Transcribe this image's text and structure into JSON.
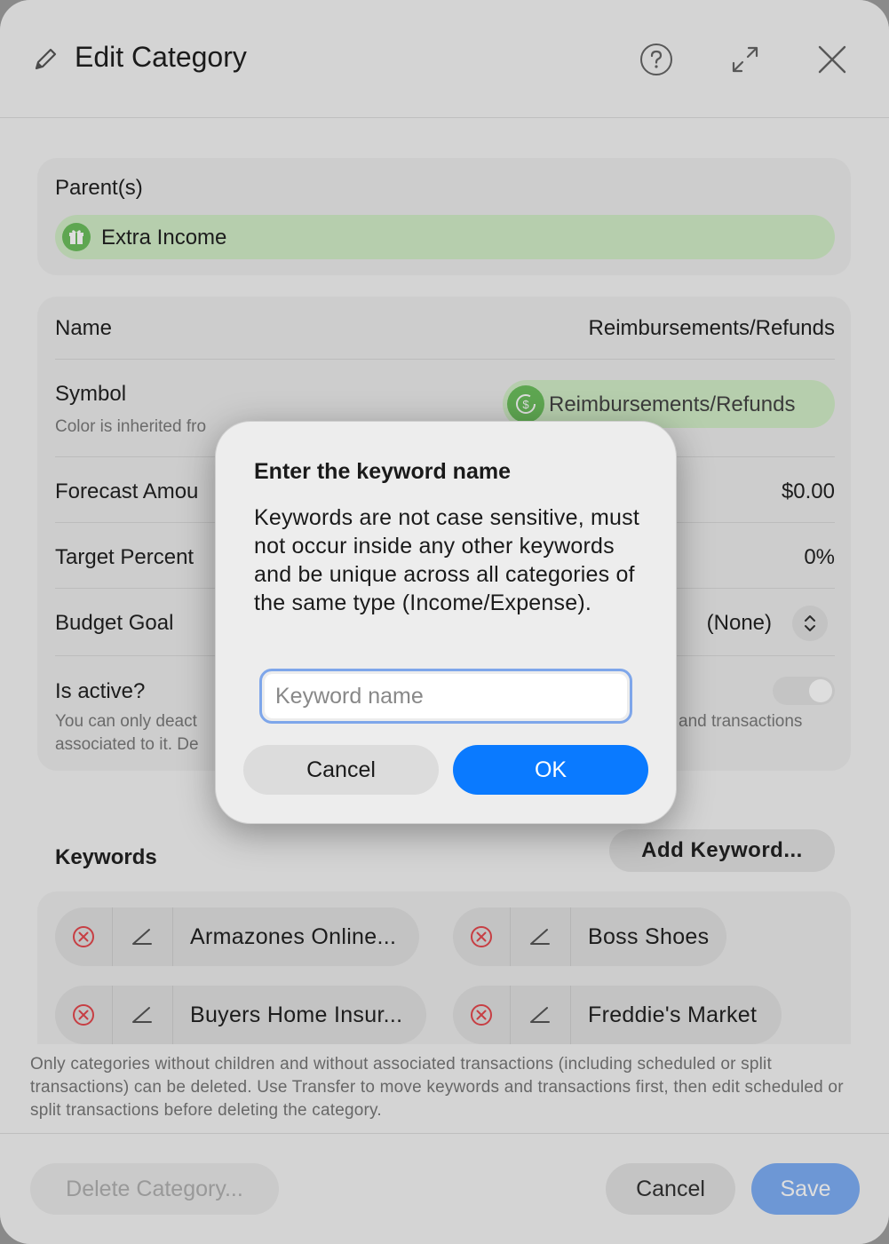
{
  "window": {
    "title": "Edit Category",
    "header_icons": [
      "pencil-icon",
      "help-icon",
      "expand-icon",
      "close-icon"
    ]
  },
  "parents": {
    "label": "Parent(s)",
    "chip_label": "Extra Income",
    "chip_icon": "gift-icon"
  },
  "details": {
    "name_label": "Name",
    "name_value": "Reimbursements/Refunds",
    "symbol_label": "Symbol",
    "symbol_sub": "Color is inherited fro",
    "symbol_value": "Reimbursements/Refunds",
    "forecast_label": "Forecast Amou",
    "forecast_value": "$0.00",
    "target_label": "Target Percent",
    "target_value": "0%",
    "budget_label": "Budget Goal",
    "budget_value": "(None)",
    "active_label": "Is active?",
    "active_sub_line1": "You can only deact",
    "active_sub_line2": "associated to it. De",
    "active_sub_right": "and transactions",
    "active_on": true
  },
  "keywords": {
    "label": "Keywords",
    "add_button": "Add Keyword...",
    "items": [
      {
        "text": "Armazones Online..."
      },
      {
        "text": "Boss Shoes"
      },
      {
        "text": "Buyers Home Insur..."
      },
      {
        "text": "Freddie's Market"
      }
    ]
  },
  "footnote": "Only categories without children and without associated transactions (including scheduled or split transactions) can be deleted. Use Transfer to move keywords and transactions first, then edit scheduled or split transactions before deleting the category.",
  "footer": {
    "delete_button": "Delete Category...",
    "cancel_button": "Cancel",
    "save_button": "Save"
  },
  "dialog": {
    "title": "Enter the keyword name",
    "message": "Keywords are not case sensitive, must not occur inside any other keywords and be unique across all categories of the same type (Income/Expense).",
    "input_placeholder": "Keyword name",
    "input_value": "",
    "cancel_button": "Cancel",
    "ok_button": "OK"
  },
  "colors": {
    "accent": "#0a7aff",
    "chip_green": "#d2edc7",
    "icon_green": "#6cbf5e",
    "remove_red": "#e5484d"
  }
}
